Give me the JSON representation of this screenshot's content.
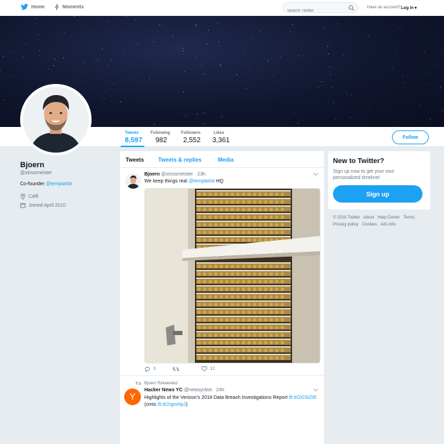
{
  "nav": {
    "home_label": "Home",
    "moments_label": "Moments",
    "search_placeholder": "Search Twitter",
    "account_prompt": "Have an account?",
    "login_label": "Log in ▾"
  },
  "profile": {
    "name": "Bjoern",
    "handle": "@zinssmeister",
    "bio_prefix": "Co-founder ",
    "bio_link": "@templarbit",
    "location": "Calif.",
    "joined": "Joined April 2010"
  },
  "stats": [
    {
      "label": "Tweets",
      "value": "8,597"
    },
    {
      "label": "Following",
      "value": "982"
    },
    {
      "label": "Followers",
      "value": "2,552"
    },
    {
      "label": "Likes",
      "value": "3,361"
    }
  ],
  "follow_label": "Follow",
  "tabs": [
    "Tweets",
    "Tweets & replies",
    "Media"
  ],
  "tweet1": {
    "name": "Bjoern",
    "meta": "@zinssmeister · 23h",
    "text_prefix": "We keep things real ",
    "text_link": "@templarbit",
    "text_suffix": " HQ",
    "replies": "3",
    "retweets": "",
    "likes": "12"
  },
  "tweet2": {
    "retweet_label": "Bjoern Retweeted",
    "avatar_letter": "Y",
    "name": "Hacker News YC",
    "meta": "@newsycbot · 24h",
    "text": "Highlights of the Verizon’s 2018 Data Breach Investigations Report ",
    "link1": "ift.tt/2GStZIE",
    "text_mid": " (cmts ",
    "link2": "ift.tt/2qpvHpJ",
    "text_end": ")"
  },
  "sidebar": {
    "title": "New to Twitter?",
    "subtitle": "Sign up now to get your own personalized timeline!",
    "signup_label": "Sign up"
  },
  "footer": [
    "© 2018 Twitter",
    "About",
    "Help Center",
    "Terms",
    "Privacy policy",
    "Cookies",
    "Ads info"
  ],
  "colors": {
    "accent": "#1da1f2",
    "hn_orange": "#ff6600"
  }
}
